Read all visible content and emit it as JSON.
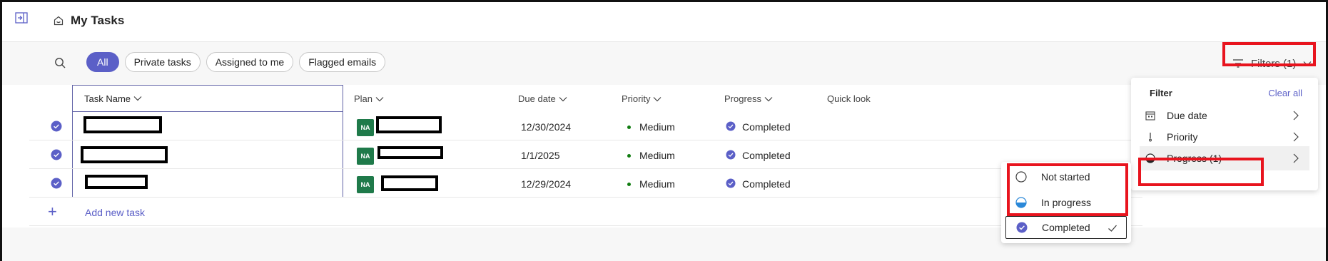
{
  "header": {
    "title": "My Tasks"
  },
  "toolbar": {
    "pills": [
      "All",
      "Private tasks",
      "Assigned to me",
      "Flagged emails"
    ],
    "filters_label": "Filters (1)"
  },
  "grid": {
    "columns": {
      "task_name": "Task Name",
      "plan": "Plan",
      "due_date": "Due date",
      "priority": "Priority",
      "progress": "Progress",
      "quick_look": "Quick look"
    },
    "rows": [
      {
        "plan_avatar": "NA",
        "due_date": "12/30/2024",
        "priority": "Medium",
        "progress": "Completed"
      },
      {
        "plan_avatar": "NA",
        "due_date": "1/1/2025",
        "priority": "Medium",
        "progress": "Completed"
      },
      {
        "plan_avatar": "NA",
        "due_date": "12/29/2024",
        "priority": "Medium",
        "progress": "Completed"
      }
    ],
    "add_new_task": "Add new task"
  },
  "filter_panel": {
    "heading": "Filter",
    "clear_all": "Clear all",
    "items": [
      "Due date",
      "Priority",
      "Progress (1)"
    ]
  },
  "progress_submenu": {
    "items": [
      "Not started",
      "In progress",
      "Completed"
    ]
  },
  "colors": {
    "accent": "#5b5fc7",
    "highlight_box": "#e8141e",
    "avatar_bg": "#1f7a4a",
    "priority_dot": "#107c10"
  }
}
